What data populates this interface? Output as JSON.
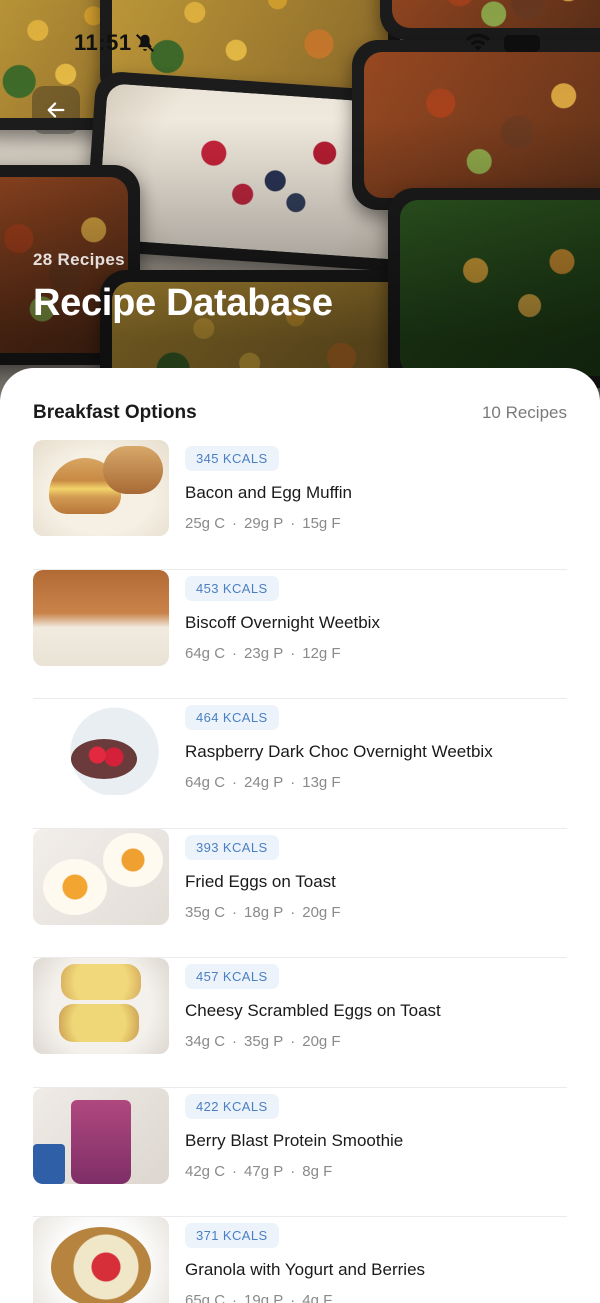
{
  "status_bar": {
    "time": "11:51"
  },
  "hero": {
    "recipe_count": "28 Recipes",
    "title": "Recipe Database"
  },
  "section": {
    "title": "Breakfast Options",
    "count": "10 Recipes"
  },
  "recipes": [
    {
      "kcal": "345 KCALS",
      "name": "Bacon and Egg Muffin",
      "carbs": "25g C",
      "protein": "29g P",
      "fat": "15g F",
      "image": "muffin"
    },
    {
      "kcal": "453 KCALS",
      "name": "Biscoff Overnight Weetbix",
      "carbs": "64g C",
      "protein": "23g P",
      "fat": "12g F",
      "image": "weetbix"
    },
    {
      "kcal": "464 KCALS",
      "name": "Raspberry Dark Choc Overnight Weetbix",
      "carbs": "64g C",
      "protein": "24g P",
      "fat": "13g F",
      "image": "raspberry"
    },
    {
      "kcal": "393 KCALS",
      "name": "Fried Eggs on Toast",
      "carbs": "35g C",
      "protein": "18g P",
      "fat": "20g F",
      "image": "fried-eggs"
    },
    {
      "kcal": "457 KCALS",
      "name": "Cheesy Scrambled Eggs on Toast",
      "carbs": "34g C",
      "protein": "35g P",
      "fat": "20g F",
      "image": "scrambled-eggs"
    },
    {
      "kcal": "422 KCALS",
      "name": "Berry Blast Protein Smoothie",
      "carbs": "42g C",
      "protein": "47g P",
      "fat": "8g F",
      "image": "smoothie"
    },
    {
      "kcal": "371 KCALS",
      "name": "Granola with Yogurt and Berries",
      "carbs": "65g C",
      "protein": "19g P",
      "fat": "4g F",
      "image": "granola"
    }
  ],
  "colors": {
    "kcal_badge_bg": "#edf3fb",
    "kcal_badge_text": "#4a7fc1",
    "divider": "#ebebeb"
  }
}
